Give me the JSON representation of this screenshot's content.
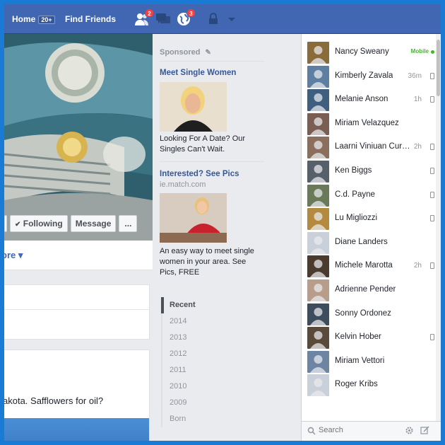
{
  "topbar": {
    "home_label": "Home",
    "home_count": "20+",
    "find_friends_label": "Find Friends",
    "friend_requests_count": "2",
    "notifications_count": "3"
  },
  "profile": {
    "following_label": "Following",
    "message_label": "Message",
    "more_button_label": "...",
    "more_tab_label": "ore ▾"
  },
  "post": {
    "text": "akota. Safflowers for oil?"
  },
  "sponsored": {
    "header": "Sponsored",
    "ads": [
      {
        "title": "Meet Single Women",
        "domain": "",
        "body": "Looking For A Date? Our Singles Can't Wait."
      },
      {
        "title": "Interested? See Pics",
        "domain": "ie.match.com",
        "body": "An easy way to meet single women in your area. See Pics, FREE"
      }
    ]
  },
  "timeline": {
    "items": [
      "Recent",
      "2014",
      "2013",
      "2012",
      "2011",
      "2010",
      "2009",
      "Born"
    ]
  },
  "chat": {
    "search_placeholder": "Search",
    "contacts": [
      {
        "name": "Nancy Sweany",
        "status": "Mobile",
        "time": "",
        "mobile": false,
        "online": true
      },
      {
        "name": "Kimberly Zavala",
        "time": "36m",
        "mobile": true
      },
      {
        "name": "Melanie Anson",
        "time": "1h",
        "mobile": true
      },
      {
        "name": "Miriam Velazquez",
        "time": "",
        "mobile": false
      },
      {
        "name": "Laarni Viniuan Cura...",
        "time": "2h",
        "mobile": true
      },
      {
        "name": "Ken Biggs",
        "time": "",
        "mobile": true
      },
      {
        "name": "C.d. Payne",
        "time": "",
        "mobile": true
      },
      {
        "name": "Lu Migliozzi",
        "time": "",
        "mobile": true
      },
      {
        "name": "Diane Landers",
        "time": "",
        "mobile": false
      },
      {
        "name": "Michele Marotta",
        "time": "2h",
        "mobile": true
      },
      {
        "name": "Adrienne Pender",
        "time": "",
        "mobile": false
      },
      {
        "name": "Sonny Ordonez",
        "time": "",
        "mobile": false
      },
      {
        "name": "Kelvin Hober",
        "time": "",
        "mobile": true
      },
      {
        "name": "Miriam Vettori",
        "time": "",
        "mobile": false
      },
      {
        "name": "Roger Kribs",
        "time": "",
        "mobile": false
      }
    ]
  },
  "colors": {
    "brand_blue": "#4267b2",
    "link_blue": "#365899",
    "notification_red": "#fa3e3e",
    "online_green": "#42b72a"
  }
}
